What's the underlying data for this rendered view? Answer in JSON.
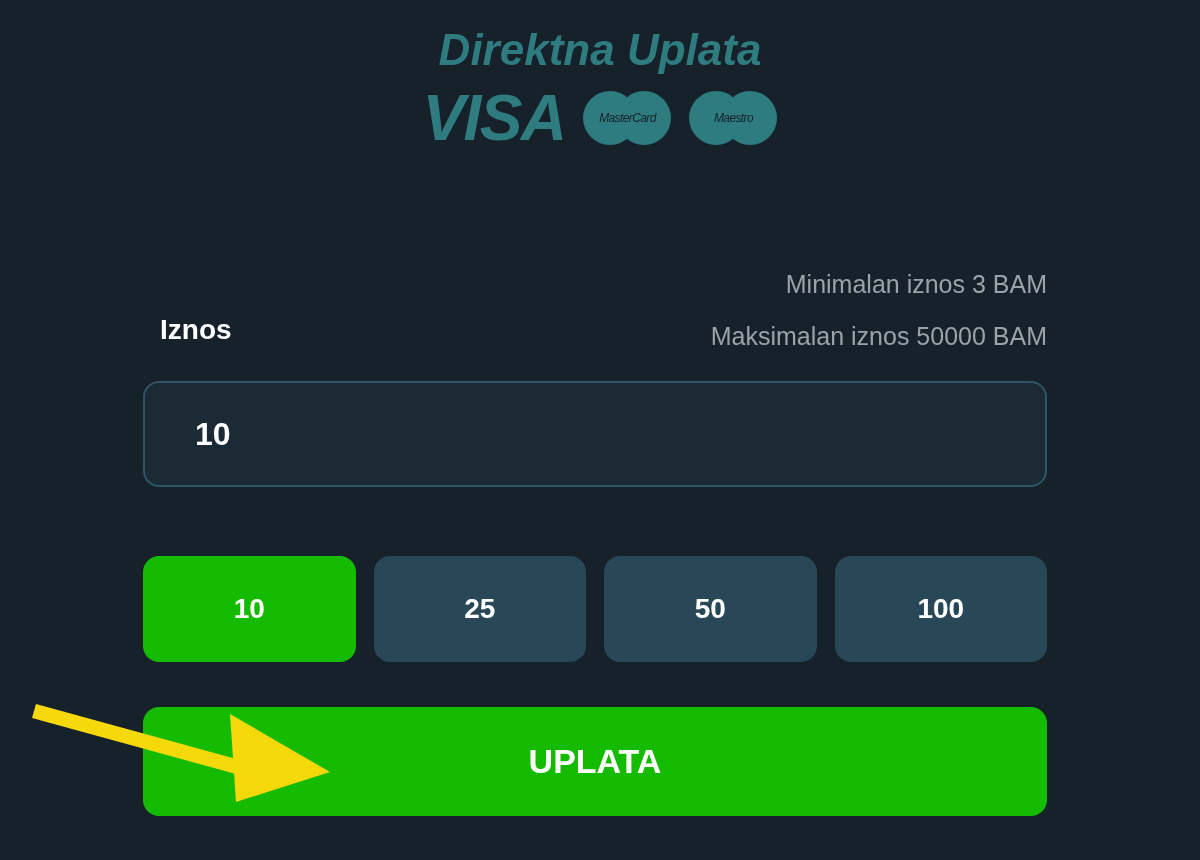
{
  "header": {
    "title": "Direktna Uplata",
    "cards": [
      {
        "kind": "visa",
        "label": "VISA"
      },
      {
        "kind": "circles",
        "label": "MasterCard"
      },
      {
        "kind": "circles",
        "label": "Maestro"
      }
    ]
  },
  "amount": {
    "label": "Iznos",
    "min_text": "Minimalan iznos 3 BAM",
    "max_text": "Maksimalan iznos 50000 BAM",
    "value": "10"
  },
  "presets": [
    {
      "label": "10",
      "selected": true
    },
    {
      "label": "25",
      "selected": false
    },
    {
      "label": "50",
      "selected": false
    },
    {
      "label": "100",
      "selected": false
    }
  ],
  "submit": {
    "label": "UPLATA"
  }
}
